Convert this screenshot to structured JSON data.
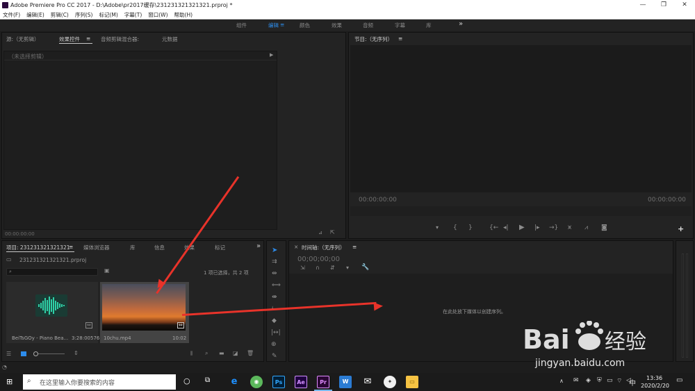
{
  "window": {
    "title": "Adobe Premiere Pro CC 2017 - D:\\Adobe\\pr2017缓存\\231231321321321.prproj *",
    "logo": "Pr"
  },
  "menus": [
    "文件(F)",
    "编辑(E)",
    "剪辑(C)",
    "序列(S)",
    "标记(M)",
    "字幕(T)",
    "窗口(W)",
    "帮助(H)"
  ],
  "workspaces": [
    "组件",
    "编辑",
    "颜色",
    "效果",
    "音频",
    "字幕",
    "库"
  ],
  "workspace_more": "≡",
  "workspace_overflow": "»",
  "source_panel": {
    "tabs": [
      "源:（无剪辑）",
      "效果控件",
      "音频剪辑混合器:",
      "元数据"
    ],
    "tab_menu": "≡",
    "header": "（未选择剪辑）",
    "timecode": "00:00:00:00"
  },
  "program_panel": {
    "title": "节目:（无序列）",
    "tab_menu": "≡",
    "timecode_left": "00:00:00:00",
    "timecode_right": "00:00:00:00",
    "add": "+"
  },
  "project_panel": {
    "tabs": [
      "项目: 231231321321321",
      "媒体浏览器",
      "库",
      "信息",
      "效果",
      "标记"
    ],
    "tab_menu": "≡",
    "overflow": "»",
    "file": "231231321321321.prproj",
    "selection": "1 项已选择，共 2 项",
    "items": [
      {
        "name": "BeiTsGOy - Piano Bea...",
        "duration": "3:28:00576"
      },
      {
        "name": "10chu.mp4",
        "duration": "10:02"
      }
    ]
  },
  "timeline_panel": {
    "title": "时间轴:（无序列）",
    "tab_menu": "≡",
    "close": "×",
    "timecode": "00;00;00;00",
    "hint": "在此处放下媒体以创建序列。"
  },
  "watermark": {
    "domain": "jingyan.baidu.com"
  },
  "taskbar": {
    "search_placeholder": "在这里输入你要搜索的内容",
    "apps": [
      "Ps",
      "Ae",
      "Pr",
      "W"
    ],
    "time": "13:36",
    "date": "2020/2/20",
    "ime": "中"
  },
  "colors": {
    "accent": "#2d8ceb",
    "arrow": "#e8332a",
    "waveform": "#2fd1a8"
  }
}
